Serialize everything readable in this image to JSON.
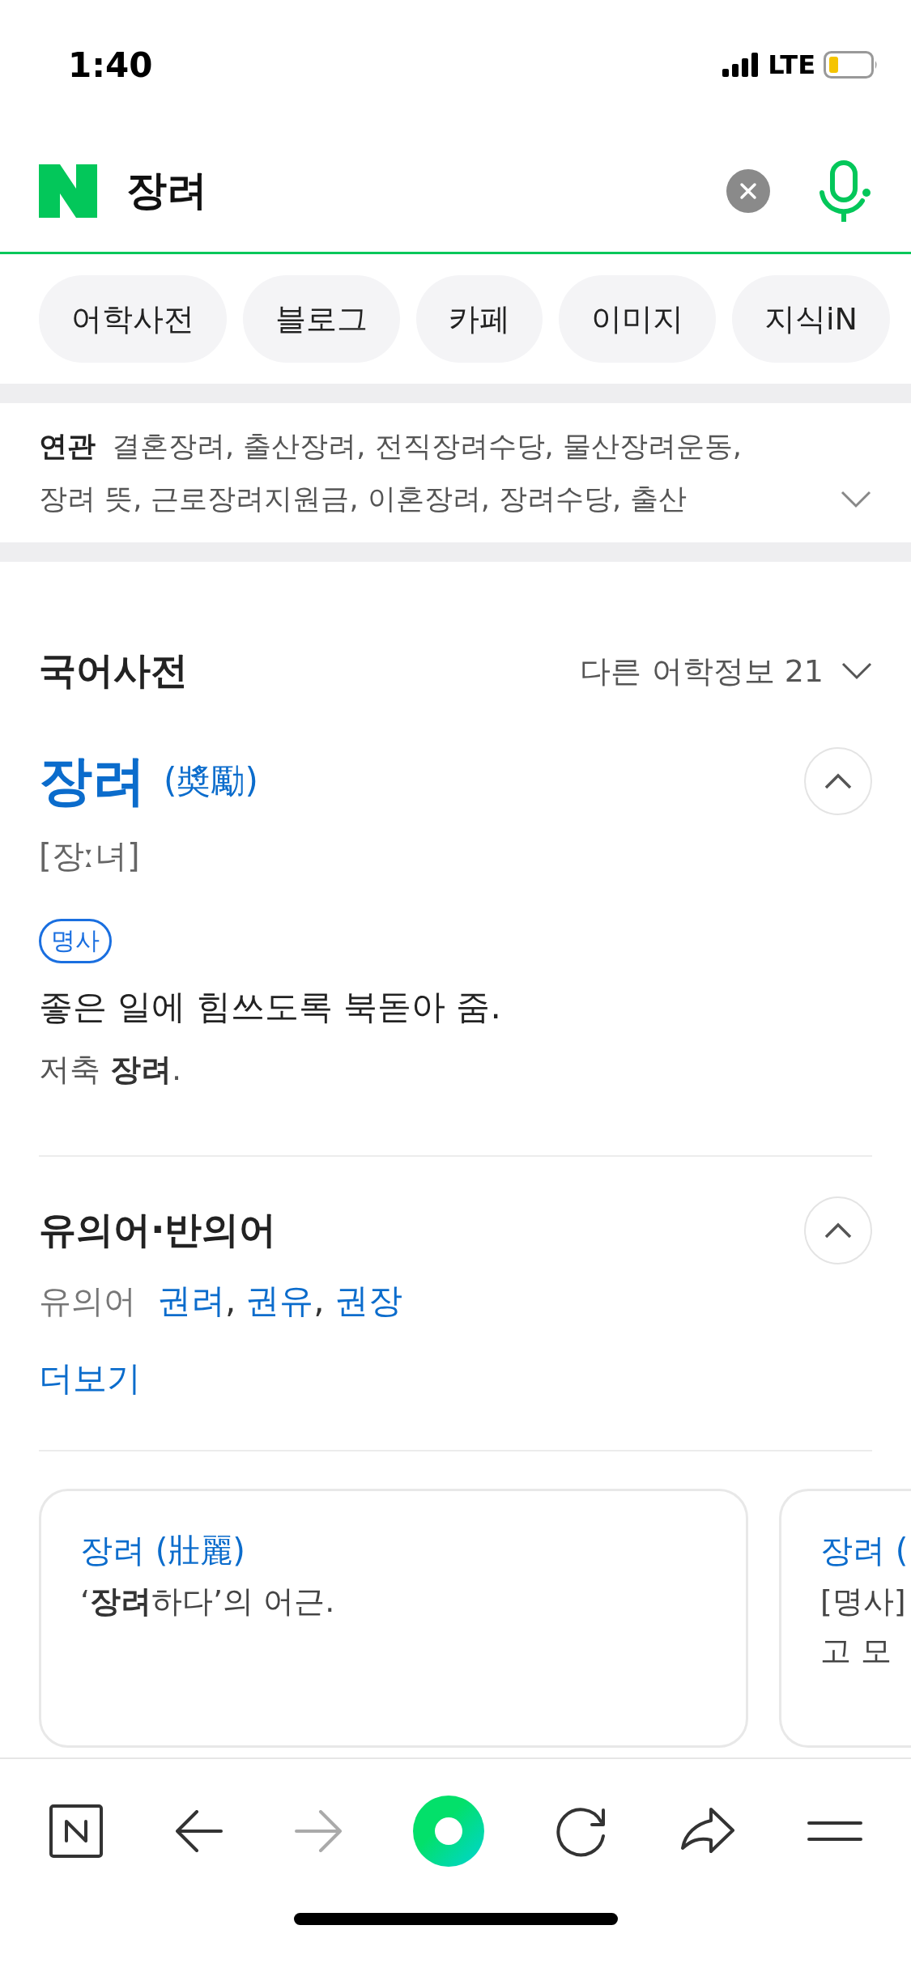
{
  "status_bar": {
    "time": "1:40",
    "network": "LTE"
  },
  "search": {
    "query": "장려"
  },
  "tabs": [
    {
      "label": "어학사전"
    },
    {
      "label": "블로그"
    },
    {
      "label": "카페"
    },
    {
      "label": "이미지"
    },
    {
      "label": "지식iN"
    }
  ],
  "related": {
    "label": "연관",
    "lines": [
      "결혼장려, 출산장려, 전직장려수당, 물산장려운동,",
      "장려 뜻, 근로장려지원금, 이혼장려, 장려수당, 출산"
    ],
    "expanded": false
  },
  "dictionary": {
    "title": "국어사전",
    "more_link": "다른 어학정보 21",
    "entry": {
      "word": "장려",
      "hanja": "(奬勵)",
      "pronunciation": "[장ː녀]",
      "expanded": true,
      "part_of_speech": "명사",
      "definition": "좋은 일에 힘쓰도록 북돋아 줌.",
      "example": "저축 **장려**."
    },
    "synonyms": {
      "title": "유의어·반의어",
      "expanded": true,
      "label": "유의어",
      "words": [
        {
          "text": "권려",
          "after": ","
        },
        {
          "text": "권유",
          "after": ","
        },
        {
          "text": "권장"
        }
      ],
      "more": "더보기"
    },
    "cards": [
      {
        "title": "장려 (壯麗)",
        "lines": [
          "‘**장려**하다’의 어근."
        ]
      },
      {
        "title": "장려 (",
        "lines": [
          "[명사]",
          "고 모"
        ]
      }
    ]
  },
  "bottom_nav": [
    {
      "kind": "naver",
      "disabled": false
    },
    {
      "kind": "back",
      "disabled": false
    },
    {
      "kind": "forward",
      "disabled": true
    },
    {
      "kind": "green-dot",
      "disabled": false
    },
    {
      "kind": "reload",
      "disabled": false
    },
    {
      "kind": "share",
      "disabled": false
    },
    {
      "kind": "menu",
      "disabled": false
    }
  ]
}
